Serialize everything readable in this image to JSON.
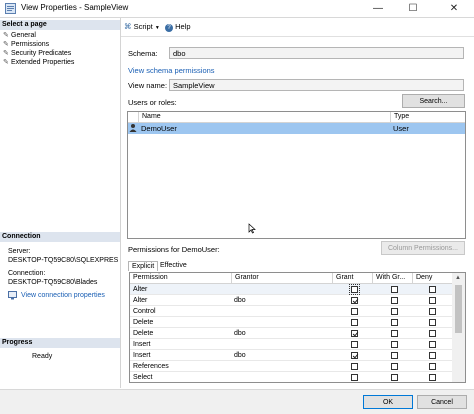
{
  "window": {
    "title": "View Properties - SampleView",
    "minimize": "—",
    "maximize": "☐",
    "close": "✕"
  },
  "left_panel": {
    "select_page": {
      "header": "Select a page",
      "items": [
        {
          "label": "General"
        },
        {
          "label": "Permissions"
        },
        {
          "label": "Security Predicates"
        },
        {
          "label": "Extended Properties"
        }
      ]
    },
    "connection": {
      "header": "Connection",
      "server_label": "Server:",
      "server_value": "DESKTOP-TQ59C80\\SQLEXPRES",
      "connection_label": "Connection:",
      "connection_value": "DESKTOP-TQ59C80\\Blades",
      "view_link": "View connection properties"
    },
    "progress": {
      "header": "Progress",
      "status": "Ready"
    }
  },
  "toolbar": {
    "script_label": "Script",
    "help_label": "Help"
  },
  "main": {
    "schema_label": "Schema:",
    "schema_value": "dbo",
    "view_schema_link": "View schema permissions",
    "view_name_label": "View name:",
    "view_name_value": "SampleView",
    "users_label": "Users or roles:",
    "search_button": "Search...",
    "users_table": {
      "headers": [
        "Name",
        "Type"
      ],
      "rows": [
        {
          "name": "DemoUser",
          "type": "User"
        }
      ]
    },
    "permissions_label": "Permissions for DemoUser:",
    "column_permissions_button": "Column Permissions...",
    "tabs": [
      {
        "label": "Explicit"
      },
      {
        "label": "Effective"
      }
    ],
    "perm_table": {
      "headers": [
        "Permission",
        "Grantor",
        "Grant",
        "With Gr...",
        "Deny"
      ],
      "rows": [
        {
          "permission": "Alter",
          "grantor": "",
          "grant": false,
          "with_grant": false,
          "deny": false
        },
        {
          "permission": "Alter",
          "grantor": "dbo",
          "grant": true,
          "with_grant": false,
          "deny": false
        },
        {
          "permission": "Control",
          "grantor": "",
          "grant": false,
          "with_grant": false,
          "deny": false
        },
        {
          "permission": "Delete",
          "grantor": "",
          "grant": false,
          "with_grant": false,
          "deny": false
        },
        {
          "permission": "Delete",
          "grantor": "dbo",
          "grant": true,
          "with_grant": false,
          "deny": false
        },
        {
          "permission": "Insert",
          "grantor": "",
          "grant": false,
          "with_grant": false,
          "deny": false
        },
        {
          "permission": "Insert",
          "grantor": "dbo",
          "grant": true,
          "with_grant": false,
          "deny": false
        },
        {
          "permission": "References",
          "grantor": "",
          "grant": false,
          "with_grant": false,
          "deny": false
        },
        {
          "permission": "Select",
          "grantor": "",
          "grant": false,
          "with_grant": false,
          "deny": false
        }
      ]
    }
  },
  "buttons": {
    "ok": "OK",
    "cancel": "Cancel"
  },
  "colors": {
    "selection": "#9dc6f0",
    "link": "#1a5fb4",
    "section_header": "#dde4ee"
  }
}
